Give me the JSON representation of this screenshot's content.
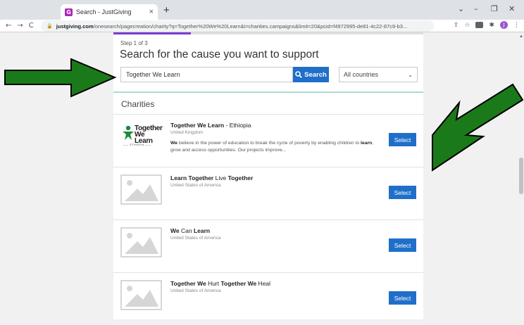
{
  "browser": {
    "tab_title": "Search - JustGiving",
    "tab_favicon_letter": "G",
    "new_tab": "+",
    "url_host": "justgiving.com",
    "url_rest": "/onesearch/pagecreation/charity?q=Together%20We%20Learn&i=charities.campaigns&limit=20&pcid=f4972995-de81-4c22-87c9-b3...",
    "profile_letter": "J"
  },
  "page": {
    "step": "Step 1 of 3",
    "heading": "Search for the cause you want to support",
    "search_value": "Together We Learn",
    "search_button": "Search",
    "country_select": "All countries",
    "section_title": "Charities",
    "progress_fraction": 0.25,
    "logo_text_1": "Together",
    "logo_text_2": "We Learn",
    "logo_sub": "ETHIOPIA"
  },
  "charities": [
    {
      "name_parts": [
        {
          "t": "Together We Learn",
          "b": true
        },
        {
          "t": " - Ethiopia",
          "b": false
        }
      ],
      "country": "United Kingdom",
      "desc_parts": [
        {
          "t": "We",
          "b": true
        },
        {
          "t": " believe in the power of education to break the cycle of poverty by enabling children to ",
          "b": false
        },
        {
          "t": "learn",
          "b": true
        },
        {
          "t": ", grow and access opportunities. Our projects improve...",
          "b": false
        }
      ],
      "select": "Select",
      "has_logo": true
    },
    {
      "name_parts": [
        {
          "t": "Learn Together",
          "b": true
        },
        {
          "t": " Live ",
          "b": false
        },
        {
          "t": "Together",
          "b": true
        }
      ],
      "country": "United States of America",
      "desc_parts": [],
      "select": "Select",
      "has_logo": false
    },
    {
      "name_parts": [
        {
          "t": "We",
          "b": true
        },
        {
          "t": " Can ",
          "b": false
        },
        {
          "t": "Learn",
          "b": true
        }
      ],
      "country": "United States of America",
      "desc_parts": [],
      "select": "Select",
      "has_logo": false
    },
    {
      "name_parts": [
        {
          "t": "Together We",
          "b": true
        },
        {
          "t": " Hurt ",
          "b": false
        },
        {
          "t": "Together We",
          "b": true
        },
        {
          "t": " Heal",
          "b": false
        }
      ],
      "country": "United States of America",
      "desc_parts": [],
      "select": "Select",
      "has_logo": false
    }
  ],
  "colors": {
    "accent": "#1f6fc9",
    "progress": "#7a3bd6",
    "divider": "#a9dcd3",
    "arrow": "#1a7a1a"
  }
}
